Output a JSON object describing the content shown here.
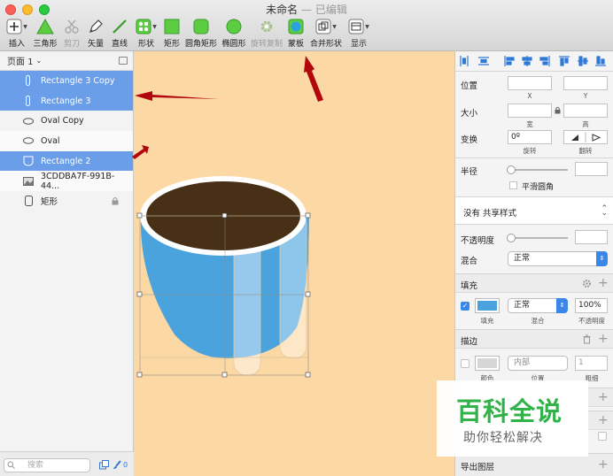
{
  "window": {
    "title": "未命名",
    "edited": "— 已编辑"
  },
  "toolbar": {
    "insert": "插入",
    "triangle": "三角形",
    "cut": "剪刀",
    "vector": "矢量",
    "line": "直线",
    "shape": "形状",
    "rect": "矩形",
    "round_rect": "圆角矩形",
    "oval": "椭圆形",
    "rotate_copy": "旋转复制",
    "mask": "蒙板",
    "combine": "合并形状",
    "view": "显示"
  },
  "colors": {
    "selection": "#6b9ee8",
    "canvas": "#fcd8a5",
    "cup_blue": "#4ba4dd",
    "coffee": "#473016",
    "arrow": "#b3050c",
    "brand_green": "#32b34a"
  },
  "layers": {
    "page_label": "页面 1",
    "items": [
      {
        "name": "Rectangle 3 Copy"
      },
      {
        "name": "Rectangle 3"
      },
      {
        "name": "Oval Copy"
      },
      {
        "name": "Oval"
      },
      {
        "name": "Rectangle 2"
      },
      {
        "name": "3CDDBA7F-991B-44..."
      },
      {
        "name": "矩形"
      }
    ],
    "search_placeholder": "搜索",
    "count": "0"
  },
  "inspector": {
    "position": "位置",
    "x": "X",
    "y": "Y",
    "size": "大小",
    "width": "宽",
    "height": "高",
    "transform": "变换",
    "rotation_value": "0º",
    "rotate": "旋转",
    "flip": "翻转",
    "radius": "半径",
    "smooth_corners": "平滑圆角",
    "shared_style": "没有 共享样式",
    "opacity": "不透明度",
    "blend": "混合",
    "blend_value": "正常",
    "fill": "填充",
    "fill_color_label": "填充",
    "fill_blend": "正常",
    "fill_blend_label": "混合",
    "fill_opacity": "100%",
    "fill_opacity_label": "不透明度",
    "border": "描边",
    "border_position": "内部",
    "border_color_label": "颜色",
    "border_position_label": "位置",
    "border_width_value": "1",
    "border_width_label": "粗细",
    "export": "导出图层"
  },
  "watermark": {
    "line1": "百科全说",
    "line2": "助你轻松解决"
  }
}
